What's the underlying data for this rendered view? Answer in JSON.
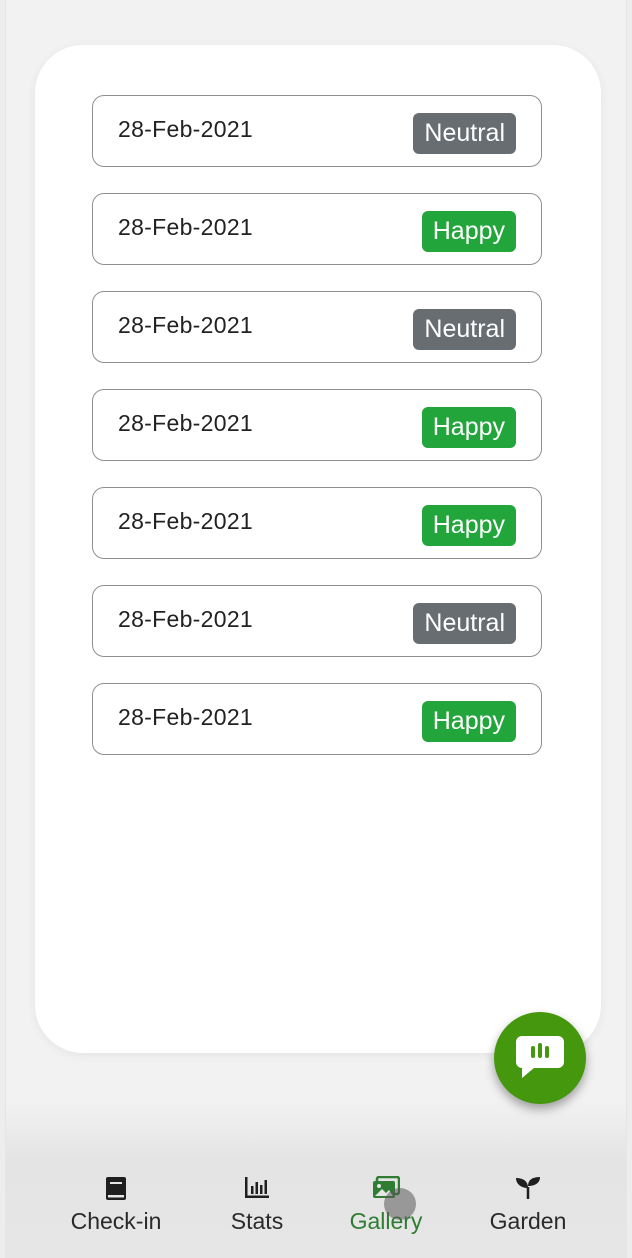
{
  "entries": [
    {
      "date": "28-Feb-2021",
      "mood": "Neutral"
    },
    {
      "date": "28-Feb-2021",
      "mood": "Happy"
    },
    {
      "date": "28-Feb-2021",
      "mood": "Neutral"
    },
    {
      "date": "28-Feb-2021",
      "mood": "Happy"
    },
    {
      "date": "28-Feb-2021",
      "mood": "Happy"
    },
    {
      "date": "28-Feb-2021",
      "mood": "Neutral"
    },
    {
      "date": "28-Feb-2021",
      "mood": "Happy"
    }
  ],
  "colors": {
    "neutral": "#686d72",
    "happy": "#22a63b",
    "fab": "#45980e",
    "active_nav": "#2e7d32"
  },
  "fab": {
    "icon": "chat-bubble-icon"
  },
  "nav": {
    "checkin": {
      "label": "Check-in",
      "icon": "book-icon"
    },
    "stats": {
      "label": "Stats",
      "icon": "bar-chart-icon"
    },
    "gallery": {
      "label": "Gallery",
      "icon": "image-icon",
      "active": true
    },
    "garden": {
      "label": "Garden",
      "icon": "sprout-icon"
    }
  }
}
